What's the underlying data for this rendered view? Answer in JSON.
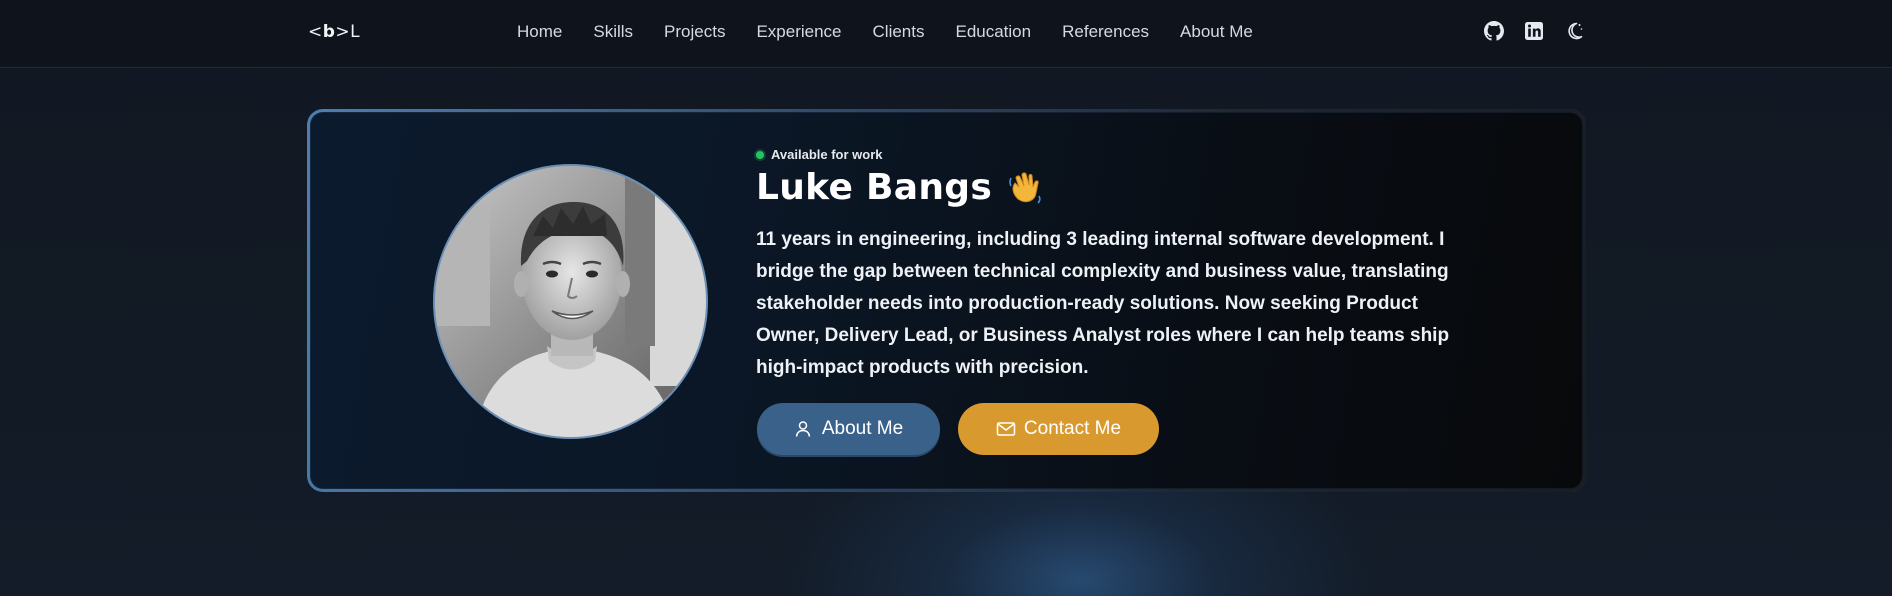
{
  "nav": {
    "logo": {
      "open": "<",
      "bold": "b",
      "close": ">",
      "letter": "L"
    },
    "links": [
      {
        "label": "Home"
      },
      {
        "label": "Skills"
      },
      {
        "label": "Projects"
      },
      {
        "label": "Experience"
      },
      {
        "label": "Clients"
      },
      {
        "label": "Education"
      },
      {
        "label": "References"
      },
      {
        "label": "About Me"
      }
    ],
    "icons": [
      "github-icon",
      "linkedin-icon",
      "theme-toggle-icon"
    ]
  },
  "hero": {
    "status": "Available for work",
    "name": "Luke Bangs",
    "bio": "11 years in engineering, including 3 leading internal software development. I bridge the gap between technical complexity and business value, translating stakeholder needs into production-ready solutions. Now seeking Product Owner, Delivery Lead, or Business Analyst roles where I can help teams ship high-impact products with precision.",
    "buttons": {
      "about": "About Me",
      "contact": "Contact Me"
    }
  },
  "colors": {
    "status_dot": "#22c55e",
    "about_button": "#3a6189",
    "contact_button": "#d89a2e",
    "card_border": "#4d7fb0"
  }
}
